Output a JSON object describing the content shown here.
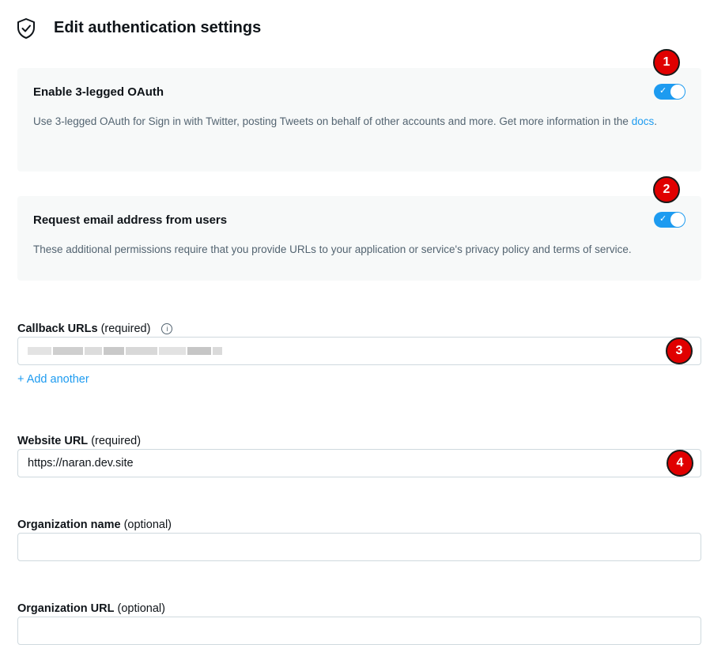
{
  "header": {
    "title": "Edit authentication settings",
    "icon": "shield-check-icon"
  },
  "oauth": {
    "title": "Enable 3-legged OAuth",
    "description": "Use 3-legged OAuth for Sign in with Twitter, posting Tweets on behalf of other accounts and more. Get more information in the",
    "docs_link": "docs",
    "period": ".",
    "enabled": true,
    "badge": "1"
  },
  "email": {
    "title": "Request email address from users",
    "description": "These additional permissions require that you provide URLs to your application or service's privacy policy and terms of service.",
    "enabled": true,
    "badge": "2"
  },
  "callback": {
    "label": "Callback URLs",
    "qualifier": "(required)",
    "value_redacted": true,
    "badge": "3",
    "add_another": "+ Add another"
  },
  "website": {
    "label": "Website URL",
    "qualifier": "(required)",
    "value": "https://naran.dev.site",
    "badge": "4"
  },
  "org_name": {
    "label": "Organization name",
    "qualifier": "(optional)",
    "value": ""
  },
  "org_url": {
    "label": "Organization URL",
    "qualifier": "(optional)",
    "value": ""
  },
  "colors": {
    "accent": "#1d9bf0",
    "badge": "#e00000",
    "card_bg": "#f7f9f9"
  }
}
